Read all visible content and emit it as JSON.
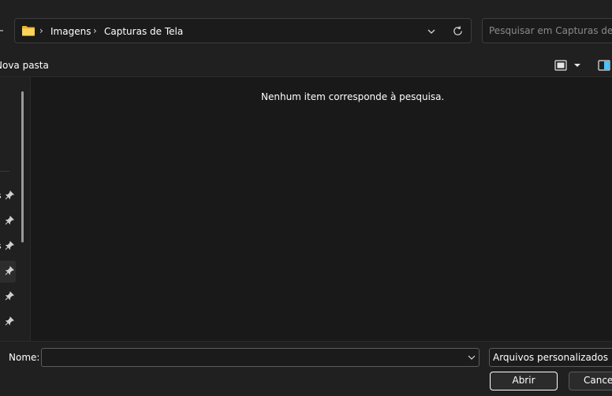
{
  "addressbar": {
    "breadcrumb": [
      "Imagens",
      "Capturas de Tela"
    ]
  },
  "search": {
    "placeholder": "Pesquisar em Capturas de T..."
  },
  "commandbar": {
    "new_folder_label": "Nova pasta"
  },
  "navigation": {
    "items": [
      {
        "label": "s"
      },
      {
        "label": ""
      },
      {
        "label": "s"
      },
      {
        "label": ""
      },
      {
        "label": ""
      },
      {
        "label": ""
      }
    ]
  },
  "main": {
    "empty_message": "Nenhum item corresponde à pesquisa."
  },
  "footer": {
    "name_label": "Nome:",
    "name_value": "",
    "file_type": "Arquivos personalizados",
    "open_label": "Abrir",
    "cancel_label": "Cancelar"
  },
  "colors": {
    "background": "#191919",
    "chrome": "#202020",
    "folder": "#f5c342",
    "accent": "#4cc2ff"
  }
}
